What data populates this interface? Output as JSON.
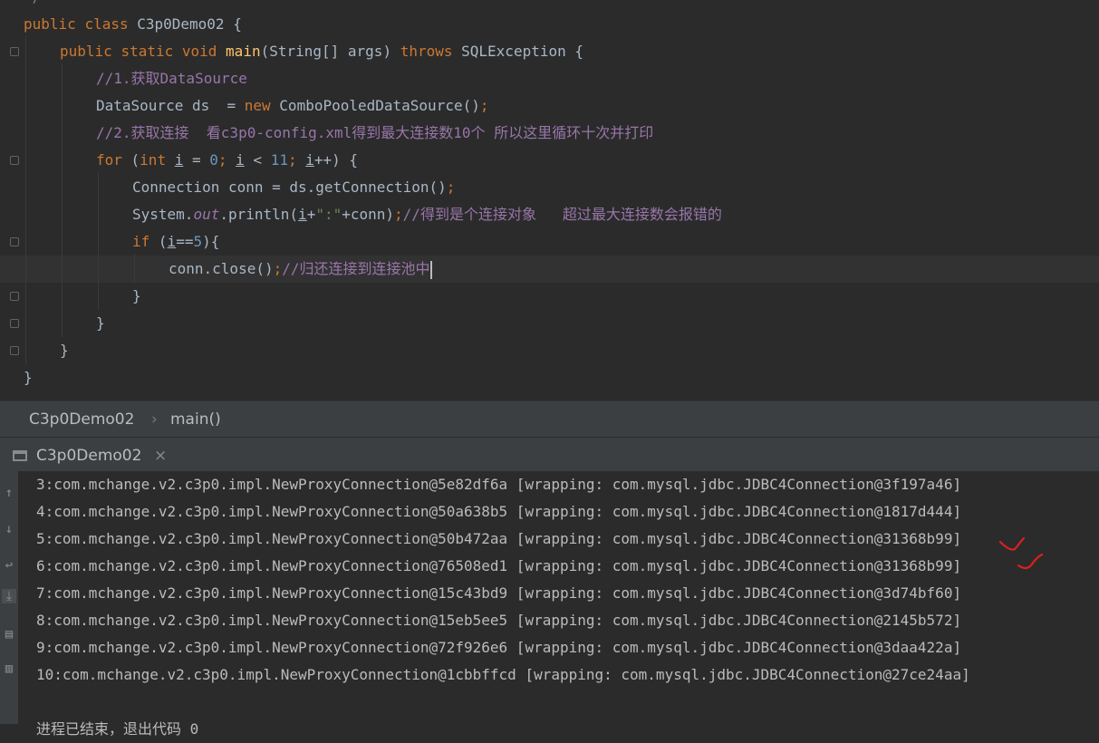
{
  "editor": {
    "lines": [
      {
        "parts": [
          {
            "t": "public ",
            "c": "kw"
          },
          {
            "t": "class ",
            "c": "kw"
          },
          {
            "t": "C3p0Demo02 {",
            "c": ""
          }
        ]
      },
      {
        "parts": [
          {
            "t": "public ",
            "c": "kw"
          },
          {
            "t": "static ",
            "c": "kw"
          },
          {
            "t": "void ",
            "c": "kw"
          },
          {
            "t": "main",
            "c": "fn"
          },
          {
            "t": "(String[] args) ",
            "c": ""
          },
          {
            "t": "throws ",
            "c": "kw"
          },
          {
            "t": "SQLException {",
            "c": ""
          }
        ]
      },
      {
        "parts": [
          {
            "t": "//1.获取DataSource",
            "c": "cm"
          }
        ]
      },
      {
        "parts": [
          {
            "t": "DataSource ds  = ",
            "c": ""
          },
          {
            "t": "new ",
            "c": "kw"
          },
          {
            "t": "ComboPooledDataSource()",
            "c": ""
          },
          {
            "t": ";",
            "c": "kw"
          }
        ]
      },
      {
        "parts": [
          {
            "t": "//2.获取连接  看c3p0-config.xml得到最大连接数10个 所以这里循环十次并打印",
            "c": "cm"
          }
        ]
      },
      {
        "parts": [
          {
            "t": "for ",
            "c": "kw"
          },
          {
            "t": "(",
            "c": ""
          },
          {
            "t": "int ",
            "c": "kw"
          },
          {
            "t": "i",
            "c": "ul"
          },
          {
            "t": " = ",
            "c": ""
          },
          {
            "t": "0",
            "c": "num"
          },
          {
            "t": "; ",
            "c": "kw"
          },
          {
            "t": "i",
            "c": "ul"
          },
          {
            "t": " < ",
            "c": ""
          },
          {
            "t": "11",
            "c": "num"
          },
          {
            "t": "; ",
            "c": "kw"
          },
          {
            "t": "i",
            "c": "ul"
          },
          {
            "t": "++) {",
            "c": ""
          }
        ]
      },
      {
        "parts": [
          {
            "t": "Connection conn = ds.getConnection()",
            "c": ""
          },
          {
            "t": ";",
            "c": "kw"
          }
        ]
      },
      {
        "parts": [
          {
            "t": "System.",
            "c": ""
          },
          {
            "t": "out",
            "c": "it"
          },
          {
            "t": ".println(",
            "c": ""
          },
          {
            "t": "i",
            "c": "ul"
          },
          {
            "t": "+",
            "c": ""
          },
          {
            "t": "\":\"",
            "c": "str"
          },
          {
            "t": "+conn)",
            "c": ""
          },
          {
            "t": ";",
            "c": "kw"
          },
          {
            "t": "//得到是个连接对象   超过最大连接数会报错的",
            "c": "cm"
          }
        ]
      },
      {
        "parts": [
          {
            "t": "if ",
            "c": "kw"
          },
          {
            "t": "(",
            "c": ""
          },
          {
            "t": "i",
            "c": "ul"
          },
          {
            "t": "==",
            "c": ""
          },
          {
            "t": "5",
            "c": "num"
          },
          {
            "t": "){",
            "c": ""
          }
        ]
      },
      {
        "parts": [
          {
            "t": "conn.close()",
            "c": ""
          },
          {
            "t": ";",
            "c": "kw"
          },
          {
            "t": "//归还连接到连接池中",
            "c": "cm"
          }
        ]
      },
      {
        "parts": [
          {
            "t": "}",
            "c": ""
          }
        ]
      },
      {
        "parts": [
          {
            "t": "}",
            "c": ""
          }
        ]
      },
      {
        "parts": [
          {
            "t": "}",
            "c": ""
          }
        ]
      },
      {
        "parts": [
          {
            "t": "}",
            "c": ""
          }
        ]
      }
    ]
  },
  "breadcrumb": {
    "class_name": "C3p0Demo02",
    "separator": "›",
    "method_name": "main()"
  },
  "run_panel": {
    "tab_label": "C3p0Demo02",
    "close_glyph": "×"
  },
  "console": {
    "lines": [
      "3:com.mchange.v2.c3p0.impl.NewProxyConnection@5e82df6a [wrapping: com.mysql.jdbc.JDBC4Connection@3f197a46]",
      "4:com.mchange.v2.c3p0.impl.NewProxyConnection@50a638b5 [wrapping: com.mysql.jdbc.JDBC4Connection@1817d444]",
      "5:com.mchange.v2.c3p0.impl.NewProxyConnection@50b472aa [wrapping: com.mysql.jdbc.JDBC4Connection@31368b99]",
      "6:com.mchange.v2.c3p0.impl.NewProxyConnection@76508ed1 [wrapping: com.mysql.jdbc.JDBC4Connection@31368b99]",
      "7:com.mchange.v2.c3p0.impl.NewProxyConnection@15c43bd9 [wrapping: com.mysql.jdbc.JDBC4Connection@3d74bf60]",
      "8:com.mchange.v2.c3p0.impl.NewProxyConnection@15eb5ee5 [wrapping: com.mysql.jdbc.JDBC4Connection@2145b572]",
      "9:com.mchange.v2.c3p0.impl.NewProxyConnection@72f926e6 [wrapping: com.mysql.jdbc.JDBC4Connection@3daa422a]",
      "10:com.mchange.v2.c3p0.impl.NewProxyConnection@1cbbffcd [wrapping: com.mysql.jdbc.JDBC4Connection@27ce24aa]",
      "",
      "进程已结束，退出代码 0"
    ]
  },
  "tools": [
    "arrow-up-icon",
    "arrow-down-icon",
    "soft-wrap-icon",
    "scroll-to-end-icon",
    "print-icon",
    "trash-icon"
  ],
  "colors": {
    "keyword": "#cc7832",
    "method": "#ffc66d",
    "comment": "#9876aa",
    "number": "#6897bb",
    "string": "#6a8759",
    "annotation_mark": "#e0201c"
  }
}
